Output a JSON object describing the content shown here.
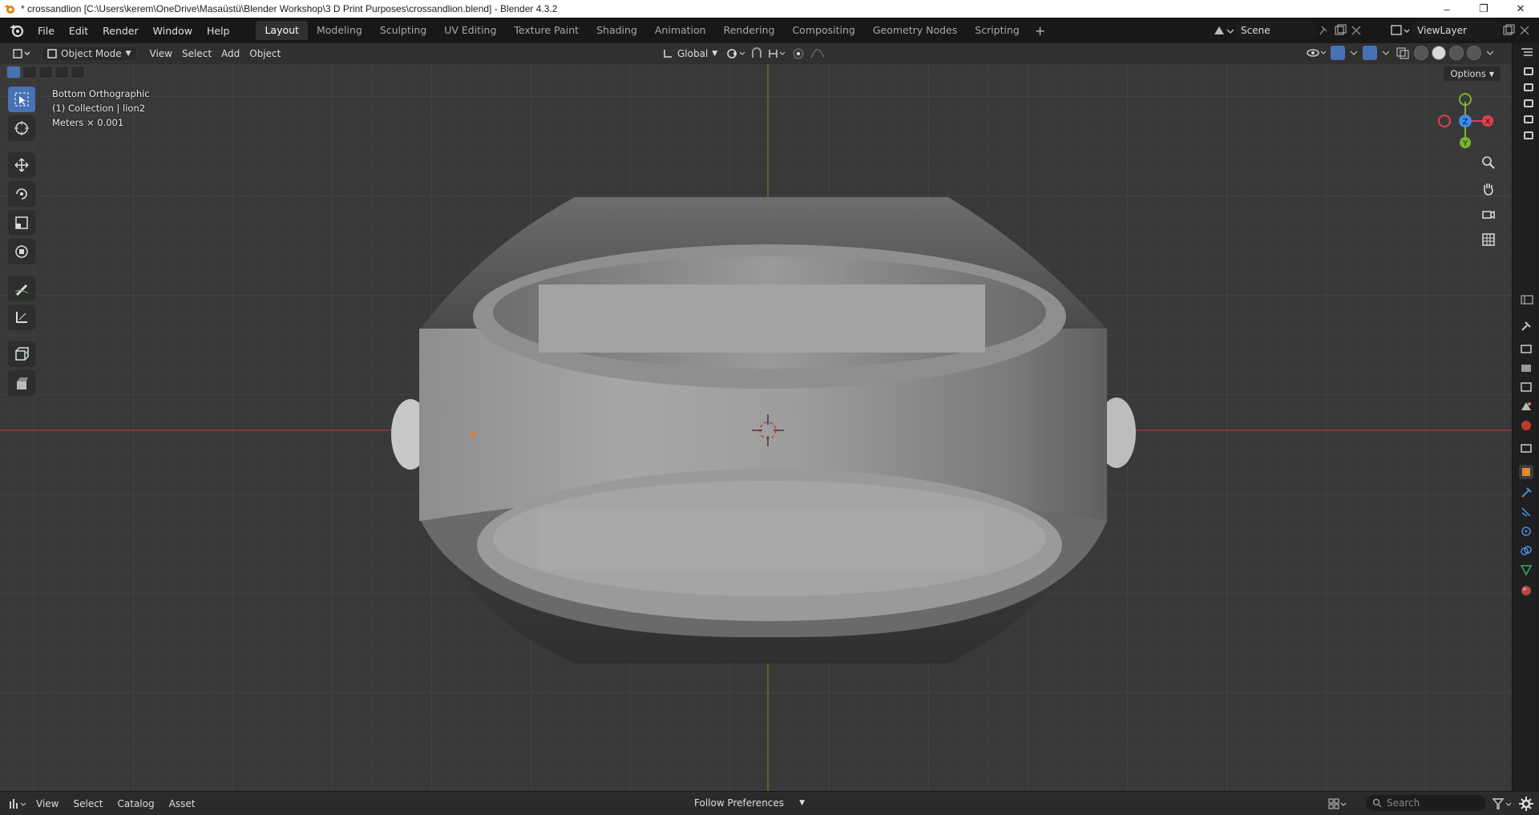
{
  "window": {
    "title": "* crossandlion [C:\\Users\\kerem\\OneDrive\\Masaüstü\\Blender Workshop\\3 D Print Purposes\\crossandlion.blend] - Blender 4.3.2",
    "controls": [
      "–",
      "❐",
      "✕"
    ]
  },
  "menu": [
    "File",
    "Edit",
    "Render",
    "Window",
    "Help"
  ],
  "workspaces": {
    "active": "Layout",
    "tabs": [
      "Layout",
      "Modeling",
      "Sculpting",
      "UV Editing",
      "Texture Paint",
      "Shading",
      "Animation",
      "Rendering",
      "Compositing",
      "Geometry Nodes",
      "Scripting"
    ],
    "add": "+"
  },
  "scene": {
    "name": "Scene"
  },
  "view_layer": {
    "name": "ViewLayer"
  },
  "viewport_header": {
    "mode": "Object Mode",
    "menus": [
      "View",
      "Select",
      "Add",
      "Object"
    ],
    "orientation": "Global",
    "options": "Options"
  },
  "viewport": {
    "view_name": "Bottom Orthographic",
    "collection": "(1) Collection | lion2",
    "units": "Meters × 0.001",
    "gizmo_axes": [
      "Z",
      "X",
      "Y"
    ]
  },
  "statusbar": {
    "menus": [
      "View",
      "Select",
      "Catalog",
      "Asset"
    ],
    "follow": "Follow Preferences",
    "search_placeholder": "Search"
  },
  "colors": {
    "accent": "#4772b3",
    "x_axis": "#e0404e",
    "y_axis": "#7ab32c",
    "z_axis": "#3f8be8"
  }
}
